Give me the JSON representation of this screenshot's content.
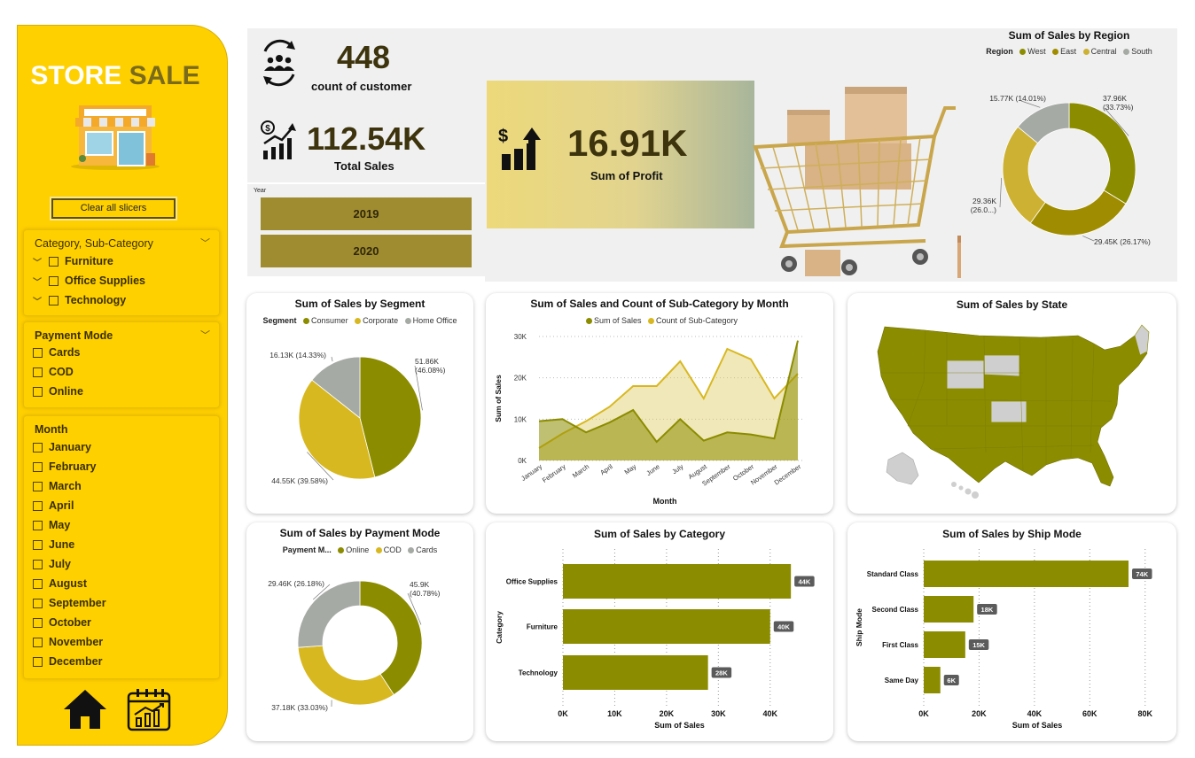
{
  "sidebar": {
    "brand_word1": "STORE",
    "brand_word2": "SALE",
    "clear_label": "Clear all slicers",
    "category_slicer": {
      "title": "Category, Sub-Category",
      "items": [
        "Furniture",
        "Office Supplies",
        "Technology"
      ]
    },
    "payment_slicer": {
      "title": "Payment Mode",
      "items": [
        "Cards",
        "COD",
        "Online"
      ]
    },
    "month_slicer": {
      "title": "Month",
      "items": [
        "January",
        "February",
        "March",
        "April",
        "May",
        "June",
        "July",
        "August",
        "September",
        "October",
        "November",
        "December"
      ]
    }
  },
  "kpis": {
    "customers": {
      "value": "448",
      "label": "count of customer"
    },
    "sales": {
      "value": "112.54K",
      "label": "Total Sales"
    },
    "profit": {
      "value": "16.91K",
      "label": "Sum of Profit"
    }
  },
  "year_slicer": {
    "title": "Year",
    "items": [
      "2019",
      "2020"
    ]
  },
  "colors": {
    "olive": "#8C8C00",
    "darkgold": "#A08C30",
    "mustard": "#D8B820",
    "gray": "#A6AAA5",
    "yellow": "#FFD000"
  },
  "charts": {
    "region": {
      "title": "Sum of Sales by Region",
      "legend_title": "Region",
      "chart_data": {
        "type": "pie",
        "categories": [
          "West",
          "East",
          "Central",
          "South"
        ],
        "values": [
          37.96,
          29.45,
          29.36,
          15.77
        ],
        "labels": [
          "37.96K (33.73%)",
          "29.45K (26.17%)",
          "29.36K (26.0...)",
          "15.77K (14.01%)"
        ],
        "colors": [
          "#8C8C00",
          "#A08C00",
          "#CDB132",
          "#A6AAA5"
        ]
      }
    },
    "segment": {
      "title": "Sum of Sales by Segment",
      "legend_title": "Segment",
      "chart_data": {
        "type": "pie",
        "categories": [
          "Consumer",
          "Corporate",
          "Home Office"
        ],
        "values": [
          51.86,
          44.55,
          16.13
        ],
        "labels": [
          "51.86K (46.08%)",
          "44.55K (39.58%)",
          "16.13K (14.33%)"
        ],
        "colors": [
          "#8C8C00",
          "#D8B820",
          "#A6AAA5"
        ]
      }
    },
    "monthly": {
      "title": "Sum of Sales and Count of Sub-Category by Month",
      "legend": [
        "Sum of Sales",
        "Count of Sub-Category"
      ],
      "xlabel": "Month",
      "ylabel": "Sum of Sales",
      "yticks": [
        "0K",
        "10K",
        "20K",
        "30K"
      ],
      "chart_data": {
        "type": "area",
        "x": [
          "January",
          "February",
          "March",
          "April",
          "May",
          "June",
          "July",
          "August",
          "September",
          "October",
          "November",
          "December"
        ],
        "ylim": [
          0,
          30000
        ],
        "series": [
          {
            "name": "Sum of Sales",
            "values": [
              9500,
              10000,
              6800,
              9200,
              12200,
              4500,
              10000,
              4800,
              6800,
              6300,
              5300,
              29000
            ]
          },
          {
            "name": "Count of Sub-Category",
            "values": [
              3000,
              6500,
              9500,
              13000,
              18000,
              18000,
              24000,
              15000,
              27000,
              24500,
              15000,
              21000
            ]
          }
        ]
      }
    },
    "state": {
      "title": "Sum of Sales by State"
    },
    "payment": {
      "title": "Sum of Sales by Payment Mode",
      "legend_title": "Payment M...",
      "chart_data": {
        "type": "pie",
        "categories": [
          "Online",
          "COD",
          "Cards"
        ],
        "values": [
          45.9,
          37.18,
          29.46
        ],
        "labels": [
          "45.9K (40.78%)",
          "37.18K (33.03%)",
          "29.46K (26.18%)"
        ],
        "colors": [
          "#8C8C00",
          "#D8B820",
          "#A6AAA5"
        ]
      }
    },
    "category": {
      "title": "Sum of Sales by Category",
      "xlabel": "Sum of Sales",
      "ylabel": "Category",
      "xticks": [
        "0K",
        "10K",
        "20K",
        "30K",
        "40K"
      ],
      "chart_data": {
        "type": "bar",
        "categories": [
          "Office Supplies",
          "Furniture",
          "Technology"
        ],
        "values": [
          44,
          40,
          28
        ],
        "labels": [
          "44K",
          "40K",
          "28K"
        ],
        "xlim": [
          0,
          45
        ]
      }
    },
    "shipmode": {
      "title": "Sum of Sales by Ship Mode",
      "xlabel": "Sum of Sales",
      "ylabel": "Ship Mode",
      "xticks": [
        "0K",
        "20K",
        "40K",
        "60K",
        "80K"
      ],
      "chart_data": {
        "type": "bar",
        "categories": [
          "Standard Class",
          "Second Class",
          "First Class",
          "Same Day"
        ],
        "values": [
          74,
          18,
          15,
          6
        ],
        "labels": [
          "74K",
          "18K",
          "15K",
          "6K"
        ],
        "xlim": [
          0,
          82
        ]
      }
    }
  }
}
